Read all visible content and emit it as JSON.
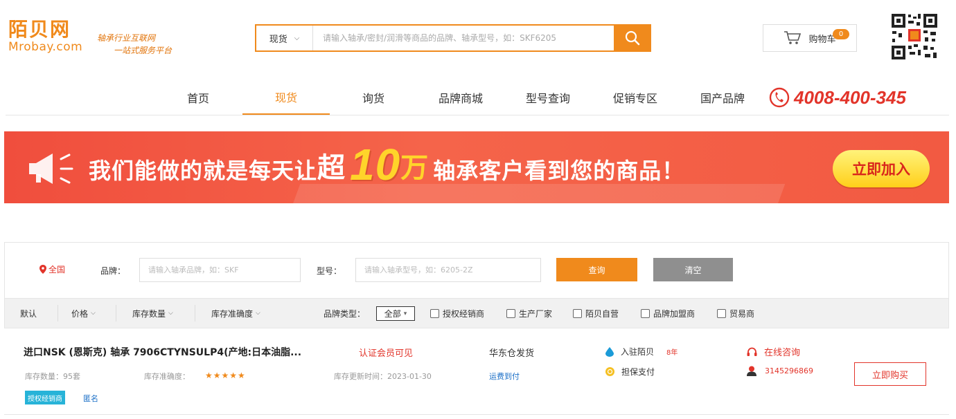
{
  "logo": {
    "cn": "陌贝网",
    "en": "Mrobay.com"
  },
  "slogan": {
    "line1": "轴承行业互联网",
    "line2": "一站式服务平台"
  },
  "search": {
    "type": "现货",
    "placeholder": "请输入轴承/密封/润滑等商品的品牌、轴承型号，如：SKF6205"
  },
  "cart": {
    "label": "购物车",
    "count": "0"
  },
  "nav": {
    "items": [
      "首页",
      "现货",
      "询货",
      "品牌商城",
      "型号查询",
      "促销专区",
      "国产品牌"
    ],
    "active_index": 1
  },
  "hotline": "4008-400-345",
  "banner": {
    "text_pre": "我们能做的就是每天让",
    "text_chao": "超",
    "text_num": "10",
    "text_wan": "万",
    "text_post": "轴承客户看到您的商品！",
    "button": "立即加入"
  },
  "filters": {
    "location": "全国",
    "brand_label": "品牌：",
    "brand_placeholder": "请输入轴承品牌，如：SKF",
    "model_label": "型号：",
    "model_placeholder": "请输入轴承型号，如：6205-2Z",
    "query": "查询",
    "clear": "清空"
  },
  "sortbar": {
    "default": "默认",
    "price": "价格",
    "stock": "库存数量",
    "accuracy": "库存准确度",
    "brand_type_label": "品牌类型：",
    "brand_type_value": "全部",
    "checks": [
      "授权经销商",
      "生产厂家",
      "陌贝自营",
      "品牌加盟商",
      "贸易商"
    ]
  },
  "product": {
    "title": "进口NSK (恩斯克) 轴承 7906CTYNSULP4(产地:日本油脂...",
    "price_note": "认证会员可见",
    "ship_from": "华东仓发货",
    "stock_label": "库存数量：",
    "stock_value": "95套",
    "accuracy_label": "库存准确度：",
    "accuracy_stars": "★★★★★",
    "updated_label": "库存更新时间：",
    "updated_value": "2023-01-30",
    "arrival": "运费到付",
    "tag_auth": "授权经销商",
    "tag_anon": "匿名",
    "feature1": "入驻陌贝",
    "feature1_badge": "8年",
    "feature2": "担保支付",
    "consult": "在线咨询",
    "phone": "3145296869",
    "buy": "立即购买"
  },
  "colors": {
    "accent": "#f08a1c",
    "red": "#e2342a",
    "blue": "#1b6fc7"
  },
  "icons": [
    "search-icon",
    "cart-icon",
    "qr-code-icon",
    "phone-icon",
    "speaker-icon",
    "location-icon",
    "headset-icon",
    "user-icon"
  ]
}
